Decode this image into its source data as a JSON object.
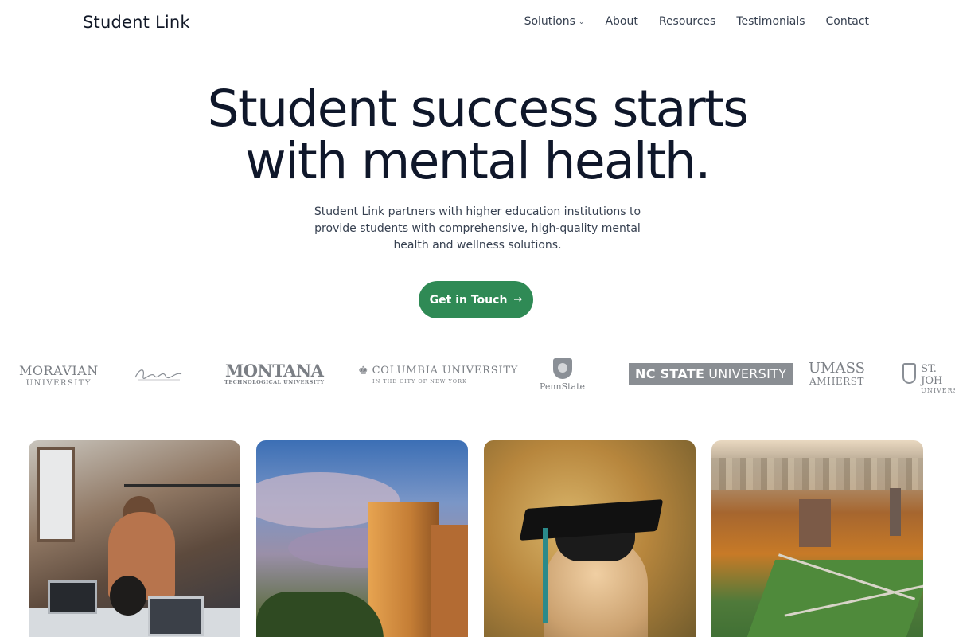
{
  "brand": {
    "name": "Student Link"
  },
  "nav": {
    "items": [
      {
        "label": "Solutions",
        "has_dropdown": true
      },
      {
        "label": "About"
      },
      {
        "label": "Resources"
      },
      {
        "label": "Testimonials"
      },
      {
        "label": "Contact"
      }
    ]
  },
  "hero": {
    "title_line1": "Student success starts",
    "title_line2": "with mental health.",
    "subtitle": "Student Link partners with higher education institutions to provide students with comprehensive, high-quality mental health and wellness solutions.",
    "cta_label": "Get in Touch",
    "cta_color": "#2f8a55"
  },
  "logos": {
    "moravian": {
      "line1": "MORAVIAN",
      "line2": "UNIVERSITY"
    },
    "montana": {
      "line1": "MONTANA",
      "line2": "TECHNOLOGICAL UNIVERSITY"
    },
    "columbia": {
      "line1": "COLUMBIA UNIVERSITY",
      "line2": "IN THE CITY OF NEW YORK"
    },
    "pennstate": {
      "line1": "PennState"
    },
    "ncstate": {
      "bold": "NC STATE",
      "rest": "UNIVERSITY"
    },
    "umass": {
      "line1": "UMASS",
      "line2": "AMHERST"
    },
    "stjohn": {
      "line1": "ST. JOH",
      "line2": "UNIVERS"
    }
  },
  "photos": {
    "items": [
      {
        "icon": "students-working-photo"
      },
      {
        "icon": "campus-building-photo"
      },
      {
        "icon": "graduate-cap-photo"
      },
      {
        "icon": "campus-aerial-photo"
      }
    ]
  }
}
